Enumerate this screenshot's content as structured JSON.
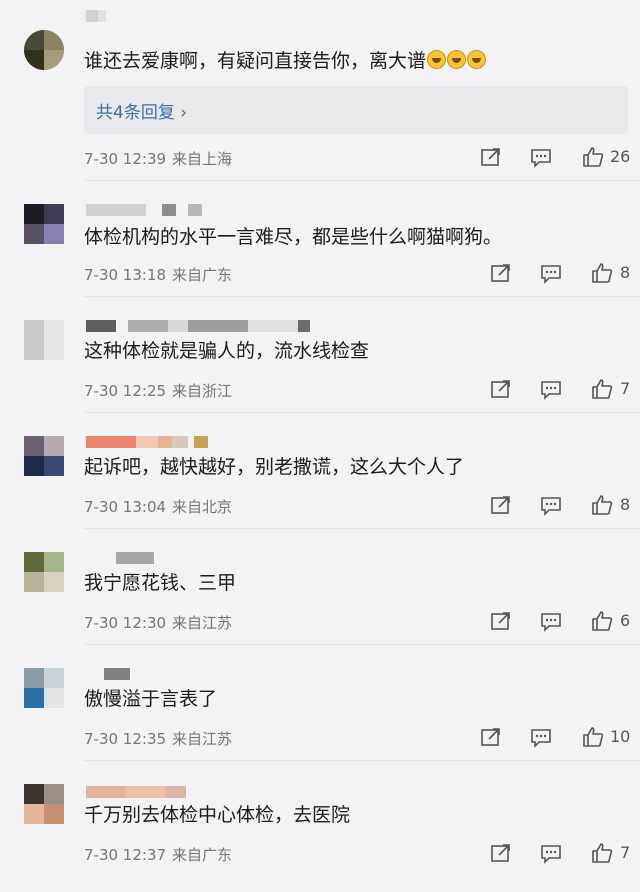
{
  "comments": [
    {
      "text": "谁还去爱康啊，有疑问直接告你，离大谱",
      "emoji": [
        "laugh-cry-emoji",
        "laugh-cry-emoji",
        "laugh-cry-emoji"
      ],
      "replies_label": "共4条回复",
      "date": "7-30 12:39",
      "location": "来自上海",
      "likes": "26"
    },
    {
      "text": "体检机构的水平一言难尽，都是些什么啊猫啊狗。",
      "date": "7-30 13:18",
      "location": "来自广东",
      "likes": "8"
    },
    {
      "text": "这种体检就是骗人的，流水线检查",
      "date": "7-30 12:25",
      "location": "来自浙江",
      "likes": "7"
    },
    {
      "text": "起诉吧，越快越好，别老撒谎，这么大个人了",
      "date": "7-30 13:04",
      "location": "来自北京",
      "likes": "8"
    },
    {
      "text": "我宁愿花钱、三甲",
      "date": "7-30 12:30",
      "location": "来自江苏",
      "likes": "6"
    },
    {
      "text": "傲慢溢于言表了",
      "date": "7-30 12:35",
      "location": "来自江苏",
      "likes": "10"
    },
    {
      "text": "千万别去体检中心体检，去医院",
      "date": "7-30 12:37",
      "location": "来自广东",
      "likes": "7"
    }
  ],
  "icons": {
    "share": "share-icon",
    "comment": "comment-icon",
    "like": "thumbs-up-icon"
  },
  "colors": {
    "background": "#f3f2f4",
    "reply_link": "#3f6ea5",
    "meta": "#767676"
  }
}
